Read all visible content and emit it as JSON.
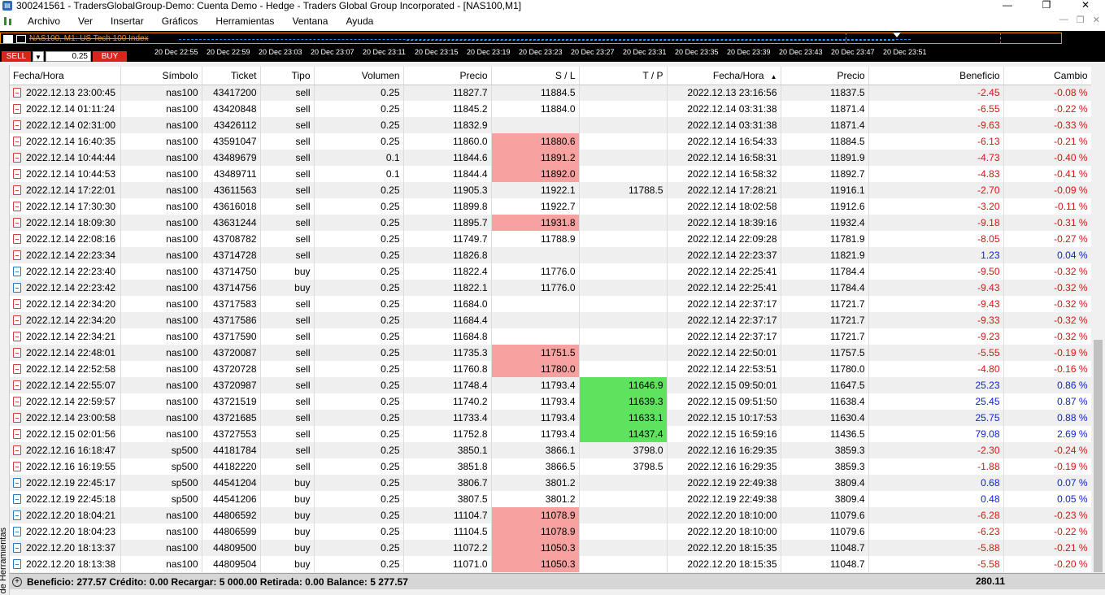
{
  "window": {
    "title": "300241561 - TradersGlobalGroup-Demo: Cuenta Demo - Hedge - Traders Global Group Incorporated - [NAS100,M1]",
    "minimize": "—",
    "maximize": "❐",
    "close": "✕"
  },
  "menu": {
    "items": [
      "Archivo",
      "Ver",
      "Insertar",
      "Gráficos",
      "Herramientas",
      "Ventana",
      "Ayuda"
    ]
  },
  "chart": {
    "label": "NAS100, M1:  US Tech 100 Index",
    "sell_label": "SELL",
    "buy_label": "BUY",
    "lot": "0.25",
    "times": [
      "20 Dec 22:55",
      "20 Dec 22:59",
      "20 Dec 23:03",
      "20 Dec 23:07",
      "20 Dec 23:11",
      "20 Dec 23:15",
      "20 Dec 23:19",
      "20 Dec 23:23",
      "20 Dec 23:27",
      "20 Dec 23:31",
      "20 Dec 23:35",
      "20 Dec 23:39",
      "20 Dec 23:43",
      "20 Dec 23:47",
      "20 Dec 23:51"
    ]
  },
  "terminal": {
    "side_tab": "de Herramientas",
    "columns": [
      "Fecha/Hora",
      "Símbolo",
      "Ticket",
      "Tipo",
      "Volumen",
      "Precio",
      "S / L",
      "T / P",
      "Fecha/Hora",
      "Precio",
      "Beneficio",
      "Cambio"
    ],
    "rows": [
      {
        "open_time": "2022.12.13 23:00:45",
        "symbol": "nas100",
        "ticket": "43417200",
        "type": "sell",
        "volume": "0.25",
        "open_price": "11827.7",
        "sl": "11884.5",
        "tp": "",
        "close_time": "2022.12.13 23:16:56",
        "close_price": "11837.5",
        "profit": "-2.45",
        "change": "-0.08 %",
        "sl_hit": false,
        "tp_hit": false
      },
      {
        "open_time": "2022.12.14 01:11:24",
        "symbol": "nas100",
        "ticket": "43420848",
        "type": "sell",
        "volume": "0.25",
        "open_price": "11845.2",
        "sl": "11884.0",
        "tp": "",
        "close_time": "2022.12.14 03:31:38",
        "close_price": "11871.4",
        "profit": "-6.55",
        "change": "-0.22 %",
        "sl_hit": false,
        "tp_hit": false
      },
      {
        "open_time": "2022.12.14 02:31:00",
        "symbol": "nas100",
        "ticket": "43426112",
        "type": "sell",
        "volume": "0.25",
        "open_price": "11832.9",
        "sl": "",
        "tp": "",
        "close_time": "2022.12.14 03:31:38",
        "close_price": "11871.4",
        "profit": "-9.63",
        "change": "-0.33 %",
        "sl_hit": false,
        "tp_hit": false
      },
      {
        "open_time": "2022.12.14 16:40:35",
        "symbol": "nas100",
        "ticket": "43591047",
        "type": "sell",
        "volume": "0.25",
        "open_price": "11860.0",
        "sl": "11880.6",
        "tp": "",
        "close_time": "2022.12.14 16:54:33",
        "close_price": "11884.5",
        "profit": "-6.13",
        "change": "-0.21 %",
        "sl_hit": true,
        "tp_hit": false
      },
      {
        "open_time": "2022.12.14 10:44:44",
        "symbol": "nas100",
        "ticket": "43489679",
        "type": "sell",
        "volume": "0.1",
        "open_price": "11844.6",
        "sl": "11891.2",
        "tp": "",
        "close_time": "2022.12.14 16:58:31",
        "close_price": "11891.9",
        "profit": "-4.73",
        "change": "-0.40 %",
        "sl_hit": true,
        "tp_hit": false
      },
      {
        "open_time": "2022.12.14 10:44:53",
        "symbol": "nas100",
        "ticket": "43489711",
        "type": "sell",
        "volume": "0.1",
        "open_price": "11844.4",
        "sl": "11892.0",
        "tp": "",
        "close_time": "2022.12.14 16:58:32",
        "close_price": "11892.7",
        "profit": "-4.83",
        "change": "-0.41 %",
        "sl_hit": true,
        "tp_hit": false
      },
      {
        "open_time": "2022.12.14 17:22:01",
        "symbol": "nas100",
        "ticket": "43611563",
        "type": "sell",
        "volume": "0.25",
        "open_price": "11905.3",
        "sl": "11922.1",
        "tp": "11788.5",
        "close_time": "2022.12.14 17:28:21",
        "close_price": "11916.1",
        "profit": "-2.70",
        "change": "-0.09 %",
        "sl_hit": false,
        "tp_hit": false
      },
      {
        "open_time": "2022.12.14 17:30:30",
        "symbol": "nas100",
        "ticket": "43616018",
        "type": "sell",
        "volume": "0.25",
        "open_price": "11899.8",
        "sl": "11922.7",
        "tp": "",
        "close_time": "2022.12.14 18:02:58",
        "close_price": "11912.6",
        "profit": "-3.20",
        "change": "-0.11 %",
        "sl_hit": false,
        "tp_hit": false
      },
      {
        "open_time": "2022.12.14 18:09:30",
        "symbol": "nas100",
        "ticket": "43631244",
        "type": "sell",
        "volume": "0.25",
        "open_price": "11895.7",
        "sl": "11931.8",
        "tp": "",
        "close_time": "2022.12.14 18:39:16",
        "close_price": "11932.4",
        "profit": "-9.18",
        "change": "-0.31 %",
        "sl_hit": true,
        "tp_hit": false
      },
      {
        "open_time": "2022.12.14 22:08:16",
        "symbol": "nas100",
        "ticket": "43708782",
        "type": "sell",
        "volume": "0.25",
        "open_price": "11749.7",
        "sl": "11788.9",
        "tp": "",
        "close_time": "2022.12.14 22:09:28",
        "close_price": "11781.9",
        "profit": "-8.05",
        "change": "-0.27 %",
        "sl_hit": false,
        "tp_hit": false
      },
      {
        "open_time": "2022.12.14 22:23:34",
        "symbol": "nas100",
        "ticket": "43714728",
        "type": "sell",
        "volume": "0.25",
        "open_price": "11826.8",
        "sl": "",
        "tp": "",
        "close_time": "2022.12.14 22:23:37",
        "close_price": "11821.9",
        "profit": "1.23",
        "change": "0.04 %",
        "sl_hit": false,
        "tp_hit": false
      },
      {
        "open_time": "2022.12.14 22:23:40",
        "symbol": "nas100",
        "ticket": "43714750",
        "type": "buy",
        "volume": "0.25",
        "open_price": "11822.4",
        "sl": "11776.0",
        "tp": "",
        "close_time": "2022.12.14 22:25:41",
        "close_price": "11784.4",
        "profit": "-9.50",
        "change": "-0.32 %",
        "sl_hit": false,
        "tp_hit": false
      },
      {
        "open_time": "2022.12.14 22:23:42",
        "symbol": "nas100",
        "ticket": "43714756",
        "type": "buy",
        "volume": "0.25",
        "open_price": "11822.1",
        "sl": "11776.0",
        "tp": "",
        "close_time": "2022.12.14 22:25:41",
        "close_price": "11784.4",
        "profit": "-9.43",
        "change": "-0.32 %",
        "sl_hit": false,
        "tp_hit": false
      },
      {
        "open_time": "2022.12.14 22:34:20",
        "symbol": "nas100",
        "ticket": "43717583",
        "type": "sell",
        "volume": "0.25",
        "open_price": "11684.0",
        "sl": "",
        "tp": "",
        "close_time": "2022.12.14 22:37:17",
        "close_price": "11721.7",
        "profit": "-9.43",
        "change": "-0.32 %",
        "sl_hit": false,
        "tp_hit": false
      },
      {
        "open_time": "2022.12.14 22:34:20",
        "symbol": "nas100",
        "ticket": "43717586",
        "type": "sell",
        "volume": "0.25",
        "open_price": "11684.4",
        "sl": "",
        "tp": "",
        "close_time": "2022.12.14 22:37:17",
        "close_price": "11721.7",
        "profit": "-9.33",
        "change": "-0.32 %",
        "sl_hit": false,
        "tp_hit": false
      },
      {
        "open_time": "2022.12.14 22:34:21",
        "symbol": "nas100",
        "ticket": "43717590",
        "type": "sell",
        "volume": "0.25",
        "open_price": "11684.8",
        "sl": "",
        "tp": "",
        "close_time": "2022.12.14 22:37:17",
        "close_price": "11721.7",
        "profit": "-9.23",
        "change": "-0.32 %",
        "sl_hit": false,
        "tp_hit": false
      },
      {
        "open_time": "2022.12.14 22:48:01",
        "symbol": "nas100",
        "ticket": "43720087",
        "type": "sell",
        "volume": "0.25",
        "open_price": "11735.3",
        "sl": "11751.5",
        "tp": "",
        "close_time": "2022.12.14 22:50:01",
        "close_price": "11757.5",
        "profit": "-5.55",
        "change": "-0.19 %",
        "sl_hit": true,
        "tp_hit": false
      },
      {
        "open_time": "2022.12.14 22:52:58",
        "symbol": "nas100",
        "ticket": "43720728",
        "type": "sell",
        "volume": "0.25",
        "open_price": "11760.8",
        "sl": "11780.0",
        "tp": "",
        "close_time": "2022.12.14 22:53:51",
        "close_price": "11780.0",
        "profit": "-4.80",
        "change": "-0.16 %",
        "sl_hit": true,
        "tp_hit": false
      },
      {
        "open_time": "2022.12.14 22:55:07",
        "symbol": "nas100",
        "ticket": "43720987",
        "type": "sell",
        "volume": "0.25",
        "open_price": "11748.4",
        "sl": "11793.4",
        "tp": "11646.9",
        "close_time": "2022.12.15 09:50:01",
        "close_price": "11647.5",
        "profit": "25.23",
        "change": "0.86 %",
        "sl_hit": false,
        "tp_hit": true
      },
      {
        "open_time": "2022.12.14 22:59:57",
        "symbol": "nas100",
        "ticket": "43721519",
        "type": "sell",
        "volume": "0.25",
        "open_price": "11740.2",
        "sl": "11793.4",
        "tp": "11639.3",
        "close_time": "2022.12.15 09:51:50",
        "close_price": "11638.4",
        "profit": "25.45",
        "change": "0.87 %",
        "sl_hit": false,
        "tp_hit": true
      },
      {
        "open_time": "2022.12.14 23:00:58",
        "symbol": "nas100",
        "ticket": "43721685",
        "type": "sell",
        "volume": "0.25",
        "open_price": "11733.4",
        "sl": "11793.4",
        "tp": "11633.1",
        "close_time": "2022.12.15 10:17:53",
        "close_price": "11630.4",
        "profit": "25.75",
        "change": "0.88 %",
        "sl_hit": false,
        "tp_hit": true
      },
      {
        "open_time": "2022.12.15 02:01:56",
        "symbol": "nas100",
        "ticket": "43727553",
        "type": "sell",
        "volume": "0.25",
        "open_price": "11752.8",
        "sl": "11793.4",
        "tp": "11437.4",
        "close_time": "2022.12.15 16:59:16",
        "close_price": "11436.5",
        "profit": "79.08",
        "change": "2.69 %",
        "sl_hit": false,
        "tp_hit": true
      },
      {
        "open_time": "2022.12.16 16:18:47",
        "symbol": "sp500",
        "ticket": "44181784",
        "type": "sell",
        "volume": "0.25",
        "open_price": "3850.1",
        "sl": "3866.1",
        "tp": "3798.0",
        "close_time": "2022.12.16 16:29:35",
        "close_price": "3859.3",
        "profit": "-2.30",
        "change": "-0.24 %",
        "sl_hit": false,
        "tp_hit": false
      },
      {
        "open_time": "2022.12.16 16:19:55",
        "symbol": "sp500",
        "ticket": "44182220",
        "type": "sell",
        "volume": "0.25",
        "open_price": "3851.8",
        "sl": "3866.5",
        "tp": "3798.5",
        "close_time": "2022.12.16 16:29:35",
        "close_price": "3859.3",
        "profit": "-1.88",
        "change": "-0.19 %",
        "sl_hit": false,
        "tp_hit": false
      },
      {
        "open_time": "2022.12.19 22:45:17",
        "symbol": "sp500",
        "ticket": "44541204",
        "type": "buy",
        "volume": "0.25",
        "open_price": "3806.7",
        "sl": "3801.2",
        "tp": "",
        "close_time": "2022.12.19 22:49:38",
        "close_price": "3809.4",
        "profit": "0.68",
        "change": "0.07 %",
        "sl_hit": false,
        "tp_hit": false
      },
      {
        "open_time": "2022.12.19 22:45:18",
        "symbol": "sp500",
        "ticket": "44541206",
        "type": "buy",
        "volume": "0.25",
        "open_price": "3807.5",
        "sl": "3801.2",
        "tp": "",
        "close_time": "2022.12.19 22:49:38",
        "close_price": "3809.4",
        "profit": "0.48",
        "change": "0.05 %",
        "sl_hit": false,
        "tp_hit": false
      },
      {
        "open_time": "2022.12.20 18:04:21",
        "symbol": "nas100",
        "ticket": "44806592",
        "type": "buy",
        "volume": "0.25",
        "open_price": "11104.7",
        "sl": "11078.9",
        "tp": "",
        "close_time": "2022.12.20 18:10:00",
        "close_price": "11079.6",
        "profit": "-6.28",
        "change": "-0.23 %",
        "sl_hit": true,
        "tp_hit": false
      },
      {
        "open_time": "2022.12.20 18:04:23",
        "symbol": "nas100",
        "ticket": "44806599",
        "type": "buy",
        "volume": "0.25",
        "open_price": "11104.5",
        "sl": "11078.9",
        "tp": "",
        "close_time": "2022.12.20 18:10:00",
        "close_price": "11079.6",
        "profit": "-6.23",
        "change": "-0.22 %",
        "sl_hit": true,
        "tp_hit": false
      },
      {
        "open_time": "2022.12.20 18:13:37",
        "symbol": "nas100",
        "ticket": "44809500",
        "type": "buy",
        "volume": "0.25",
        "open_price": "11072.2",
        "sl": "11050.3",
        "tp": "",
        "close_time": "2022.12.20 18:15:35",
        "close_price": "11048.7",
        "profit": "-5.88",
        "change": "-0.21 %",
        "sl_hit": true,
        "tp_hit": false
      },
      {
        "open_time": "2022.12.20 18:13:38",
        "symbol": "nas100",
        "ticket": "44809504",
        "type": "buy",
        "volume": "0.25",
        "open_price": "11071.0",
        "sl": "11050.3",
        "tp": "",
        "close_time": "2022.12.20 18:15:35",
        "close_price": "11048.7",
        "profit": "-5.58",
        "change": "-0.20 %",
        "sl_hit": true,
        "tp_hit": false
      }
    ],
    "summary": {
      "text": "Beneficio: 277.57  Crédito: 0.00  Recargar: 5 000.00  Retirada: 0.00  Balance: 5 277.57",
      "total": "280.11"
    }
  },
  "colors": {
    "sl_hit": "#f7a1a1",
    "tp_hit": "#5fe35f",
    "negative": "#e01010",
    "positive": "#1020e0",
    "sell_button": "#d9261c"
  }
}
